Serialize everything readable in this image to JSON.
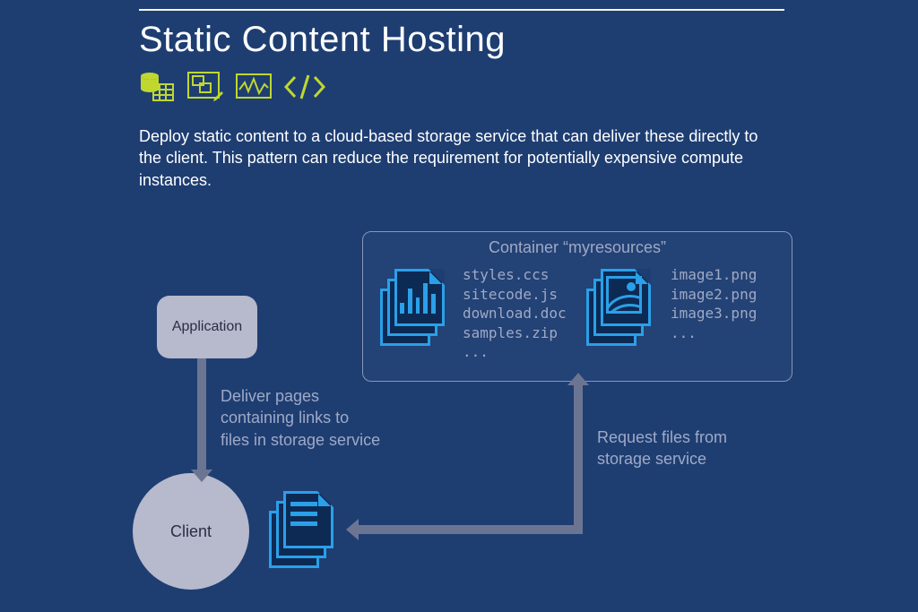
{
  "title": "Static Content Hosting",
  "description": "Deploy static content to a cloud-based storage service that can deliver these directly to the client. This pattern can reduce the requirement for potentially expensive compute instances.",
  "icons": {
    "accent": "#c0d72f",
    "items": [
      "database-table-icon",
      "design-tool-icon",
      "monitoring-icon",
      "code-icon"
    ]
  },
  "diagram": {
    "application_label": "Application",
    "client_label": "Client",
    "container_title": "Container “myresources”",
    "file_group_1": [
      "styles.ccs",
      "sitecode.js",
      "download.doc",
      "samples.zip",
      "..."
    ],
    "file_group_2": [
      "image1.png",
      "image2.png",
      "image3.png",
      "..."
    ],
    "flow_app_to_client": "Deliver pages containing links to files in storage service",
    "flow_client_to_container": "Request files from storage service"
  }
}
